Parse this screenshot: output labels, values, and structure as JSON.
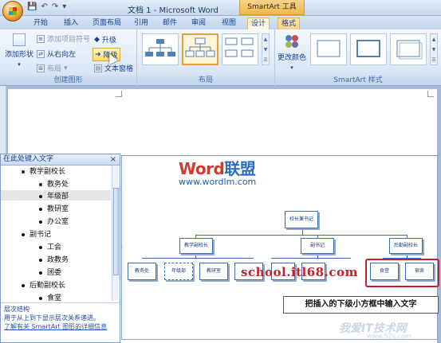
{
  "title_bar": {
    "window_title": "文档 1 - Microsoft Word",
    "context_tool_title": "SmartArt 工具",
    "qat": [
      "save-icon",
      "undo-icon",
      "redo-icon",
      "dropdown-icon"
    ]
  },
  "tabs": [
    {
      "label": "开始"
    },
    {
      "label": "插入"
    },
    {
      "label": "页面布局"
    },
    {
      "label": "引用"
    },
    {
      "label": "邮件"
    },
    {
      "label": "审阅"
    },
    {
      "label": "视图"
    },
    {
      "label": "设计"
    },
    {
      "label": "格式"
    }
  ],
  "ribbon": {
    "create_graphic": {
      "label": "创建图形",
      "add_shape": "添加形状",
      "add_bullet": "添加项目符号",
      "right_to_left": "从右向左",
      "layout": "布局",
      "promote": "升级",
      "demote": "降级",
      "text_pane": "文本窗格"
    },
    "layouts": {
      "label": "布局"
    },
    "styles": {
      "label": "SmartArt 样式",
      "change_colors": "更改颜色"
    }
  },
  "text_pane": {
    "title": "在此处键入文字",
    "close": "×",
    "items": [
      {
        "text": "教学副校长",
        "level": 1
      },
      {
        "text": "教务处",
        "level": 2
      },
      {
        "text": "年级部",
        "level": 2,
        "selected": true
      },
      {
        "text": "教研室",
        "level": 2
      },
      {
        "text": "办公室",
        "level": 2
      },
      {
        "text": "副书记",
        "level": 1
      },
      {
        "text": "工会",
        "level": 2
      },
      {
        "text": "政教务",
        "level": 2
      },
      {
        "text": "团委",
        "level": 2
      },
      {
        "text": "后勤副校长",
        "level": 1
      },
      {
        "text": "食堂",
        "level": 2
      }
    ],
    "footer": {
      "heading": "层次结构",
      "desc": "用于从上到下显示层次关系递进。",
      "link": "了解有关 SmartArt 图形的详细信息"
    }
  },
  "diagram": {
    "root": "校长兼书记",
    "level1": [
      "教学副校长",
      "副书记",
      "后勤副校长"
    ],
    "level2": [
      "教务处",
      "年级部",
      "教研室",
      "",
      "",
      "",
      "食堂",
      "宿舍"
    ]
  },
  "watermarks": {
    "logo_word": "Word",
    "logo_cn": "联盟",
    "url": "www.wordlm.com",
    "school": "school.itl68.com",
    "site": "我爱IT技术网",
    "site_url": "www.52ij.com"
  },
  "annotation": "把插入的下级小方框中输入文字"
}
